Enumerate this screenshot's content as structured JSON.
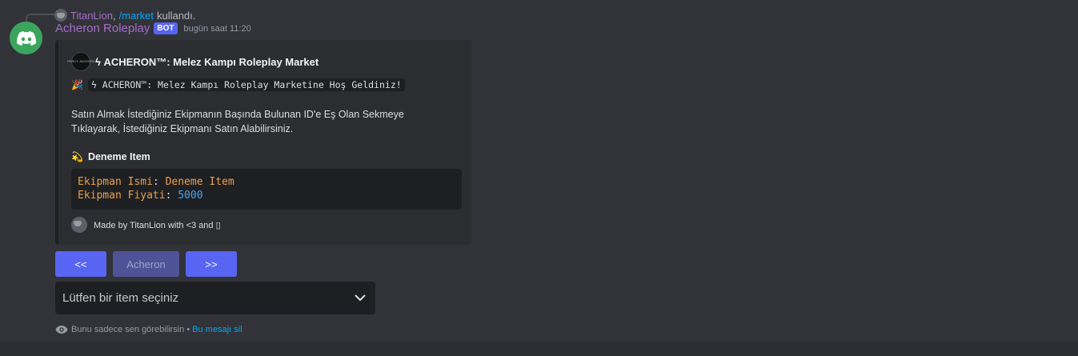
{
  "reply": {
    "user": "TitanLion",
    "separator": ",",
    "command": "/market",
    "text": "kullandı."
  },
  "message": {
    "username": "Acheron Roleplay",
    "badge": "BOT",
    "timestamp": "bugün saat 11:20"
  },
  "embed": {
    "author_icon_text": "PERCY JACKSON",
    "title": "ϟ ACHERON™: Melez Kampı Roleplay Market",
    "welcome_emoji": "🎉",
    "welcome_code": "ϟ  ACHERON™: Melez Kampı Roleplay Marketine Hoş Geldiniz!",
    "description": "Satın Almak İstediğiniz Ekipmanın Başında Bulunan ID'e Eş Olan Sekmeye Tıklayarak, İstediğiniz Ekipmanı Satın Alabilirsiniz.",
    "field_emoji": "💫",
    "field_name": "Deneme Item",
    "code": {
      "line1_key": "Ekipman Ismi",
      "line1_sep": ": ",
      "line1_value": "Deneme Item",
      "line2_key": "Ekipman Fiyati",
      "line2_sep": ": ",
      "line2_value": "5000"
    },
    "footer": "Made by TitanLion with <3 and ▯"
  },
  "buttons": {
    "prev": "<<",
    "middle": "Acheron",
    "next": ">>"
  },
  "select": {
    "placeholder": "Lütfen bir item seçiniz"
  },
  "ephemeral": {
    "text": "Bunu sadece sen görebilirsin •",
    "link": "Bu mesajı sil"
  },
  "colors": {
    "background": "#313338",
    "embed_bg": "#2b2d31",
    "blurple": "#5865f2",
    "username": "#a66dc7",
    "link": "#00a8fc",
    "avatar_green": "#3ba55d"
  },
  "icons": {
    "avatar": "discord-logo-icon",
    "select_arrow": "chevron-down-icon",
    "ephemeral": "eye-icon"
  }
}
